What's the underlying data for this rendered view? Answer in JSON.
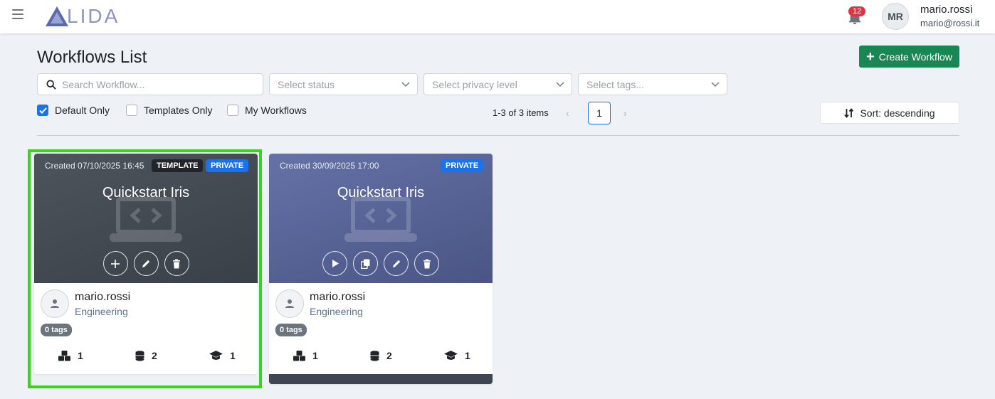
{
  "header": {
    "logo_text": "LIDA",
    "notification_count": "12",
    "avatar_initials": "MR",
    "user_name": "mario.rossi",
    "user_email": "mario@rossi.it"
  },
  "page": {
    "title": "Workflows List",
    "create_label": "Create Workflow"
  },
  "filters": {
    "search_placeholder": "Search Workflow...",
    "status_placeholder": "Select status",
    "privacy_placeholder": "Select privacy level",
    "tags_placeholder": "Select tags..."
  },
  "checkboxes": [
    {
      "label": "Default Only",
      "checked": true
    },
    {
      "label": "Templates Only",
      "checked": false
    },
    {
      "label": "My Workflows",
      "checked": false
    }
  ],
  "pagination": {
    "summary": "1-3 of 3 items",
    "current_page": "1",
    "prev": "‹",
    "next": "›"
  },
  "sort": {
    "label": "Sort: descending"
  },
  "cards": [
    {
      "created": "Created 07/10/2025 16:45",
      "badges": [
        "TEMPLATE",
        "PRIVATE"
      ],
      "title": "Quickstart Iris",
      "owner": "mario.rossi",
      "department": "Engineering",
      "tags": "0 tags",
      "stats": [
        "1",
        "2",
        "1"
      ],
      "actions": [
        "plus-icon",
        "pencil-icon",
        "trash-icon"
      ]
    },
    {
      "created": "Created 30/09/2025 17:00",
      "badges": [
        "PRIVATE"
      ],
      "title": "Quickstart Iris",
      "owner": "mario.rossi",
      "department": "Engineering",
      "tags": "0 tags",
      "stats": [
        "1",
        "2",
        "1"
      ],
      "actions": [
        "play-icon",
        "copy-icon",
        "pencil-icon",
        "trash-icon"
      ]
    }
  ],
  "colors": {
    "accent": "#1a73e8",
    "create_button": "#198754",
    "selection_outline": "#3ad31c",
    "badge_template": "#212529",
    "badge_private": "#1a73e8"
  }
}
